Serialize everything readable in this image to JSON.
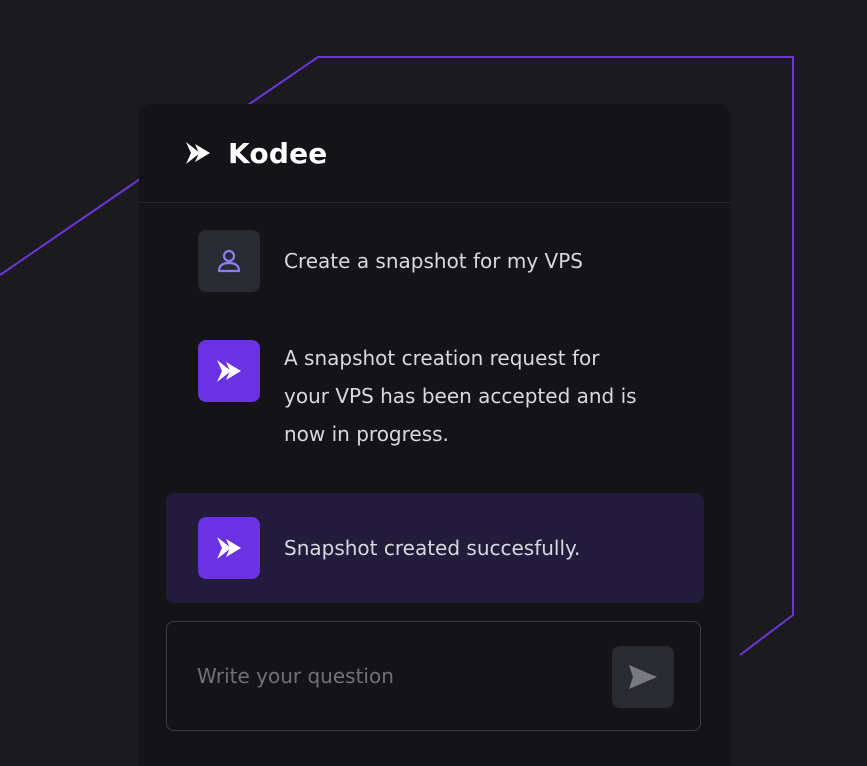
{
  "header": {
    "brand_name": "Kodee",
    "logo_icon": "kodee-logo-icon"
  },
  "messages": [
    {
      "role": "user",
      "icon": "user-icon",
      "text": "Create a snapshot for my VPS"
    },
    {
      "role": "assistant",
      "icon": "kodee-logo-icon",
      "lines": [
        "A snapshot creation request for",
        "your VPS has been accepted and is",
        "now in progress."
      ]
    },
    {
      "role": "assistant",
      "icon": "kodee-logo-icon",
      "text": "Snapshot created succesfully.",
      "highlighted": true
    }
  ],
  "input": {
    "placeholder": "Write your question",
    "value": "",
    "send_icon": "send-icon"
  },
  "colors": {
    "background": "#1b1b1f",
    "panel": "#141418",
    "accent": "#6a32e3",
    "accent_line": "#6b35d8",
    "highlight": "#221b3b"
  }
}
